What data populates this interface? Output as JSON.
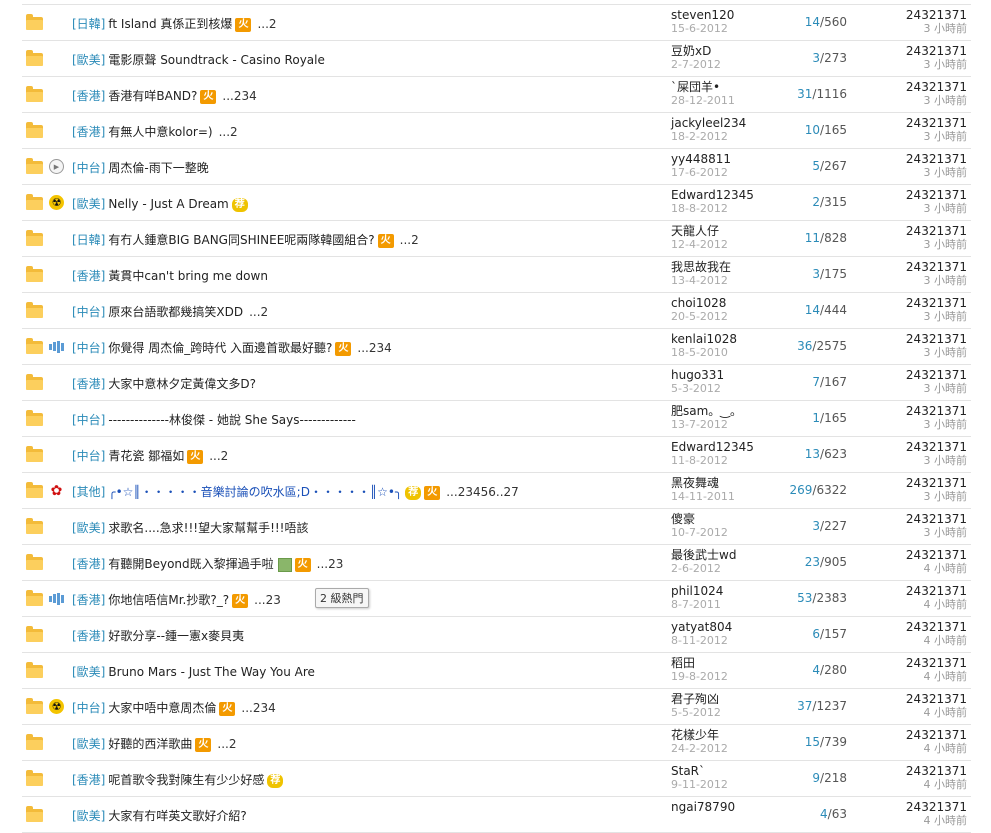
{
  "threads": [
    {
      "icon": "",
      "category": "[日韓]",
      "title": "ft Island 真係正到核爆",
      "badges": [
        "hot"
      ],
      "pages": [
        "...",
        "2"
      ],
      "author": "steven120",
      "date": "15-6-2012",
      "replies": "14",
      "views": "560",
      "last_user": "24321371",
      "last_time": "3 小時前"
    },
    {
      "icon": "",
      "category": "[歐美]",
      "title": "電影原聲 Soundtrack - Casino Royale",
      "badges": [],
      "pages": [],
      "author": "豆奶xD",
      "date": "2-7-2012",
      "replies": "3",
      "views": "273",
      "last_user": "24321371",
      "last_time": "3 小時前"
    },
    {
      "icon": "",
      "category": "[香港]",
      "title": "香港有咩BAND?",
      "badges": [
        "hot"
      ],
      "pages": [
        "...",
        "2",
        "3",
        "4"
      ],
      "author": "`屎団羊•",
      "date": "28-12-2011",
      "replies": "31",
      "views": "1116",
      "last_user": "24321371",
      "last_time": "3 小時前"
    },
    {
      "icon": "",
      "category": "[香港]",
      "title": "有無人中意kolor=)",
      "badges": [],
      "pages": [
        "...",
        "2"
      ],
      "author": "jackyleel234",
      "date": "18-2-2012",
      "replies": "10",
      "views": "165",
      "last_user": "24321371",
      "last_time": "3 小時前"
    },
    {
      "icon": "play",
      "category": "[中台]",
      "title": "周杰倫-雨下一整晚",
      "badges": [],
      "pages": [],
      "author": "yy448811",
      "date": "17-6-2012",
      "replies": "5",
      "views": "267",
      "last_user": "24321371",
      "last_time": "3 小時前"
    },
    {
      "icon": "nuke",
      "category": "[歐美]",
      "title": "Nelly - Just A Dream",
      "badges": [
        "rec"
      ],
      "pages": [],
      "author": "Edward12345",
      "date": "18-8-2012",
      "replies": "2",
      "views": "315",
      "last_user": "24321371",
      "last_time": "3 小時前"
    },
    {
      "icon": "",
      "category": "[日韓]",
      "title": "有冇人鍾意BIG BANG同SHINEE呢兩隊韓國組合?",
      "badges": [
        "hot"
      ],
      "pages": [
        "...",
        "2"
      ],
      "author": "天龍人仔",
      "date": "12-4-2012",
      "replies": "11",
      "views": "828",
      "last_user": "24321371",
      "last_time": "3 小時前"
    },
    {
      "icon": "",
      "category": "[香港]",
      "title": "黃貫中can't bring me down",
      "badges": [],
      "pages": [],
      "author": "我思故我在",
      "date": "13-4-2012",
      "replies": "3",
      "views": "175",
      "last_user": "24321371",
      "last_time": "3 小時前"
    },
    {
      "icon": "",
      "category": "[中台]",
      "title": "原來台語歌都幾搞笑XDD",
      "badges": [],
      "pages": [
        "...",
        "2"
      ],
      "author": "choi1028",
      "date": "20-5-2012",
      "replies": "14",
      "views": "444",
      "last_user": "24321371",
      "last_time": "3 小時前"
    },
    {
      "icon": "bars",
      "category": "[中台]",
      "title": "你覺得 周杰倫_跨時代 入面邊首歌最好聽?",
      "badges": [
        "hot"
      ],
      "pages": [
        "...",
        "2",
        "3",
        "4"
      ],
      "author": "kenlai1028",
      "date": "18-5-2010",
      "replies": "36",
      "views": "2575",
      "last_user": "24321371",
      "last_time": "3 小時前"
    },
    {
      "icon": "",
      "category": "[香港]",
      "title": "大家中意林夕定黃偉文多D?",
      "badges": [],
      "pages": [],
      "author": "hugo331",
      "date": "5-3-2012",
      "replies": "7",
      "views": "167",
      "last_user": "24321371",
      "last_time": "3 小時前"
    },
    {
      "icon": "",
      "category": "[中台]",
      "title": "--------------林俊傑 - 她說 She Says-------------",
      "badges": [],
      "pages": [],
      "author": "肥sam。‿。",
      "date": "13-7-2012",
      "replies": "1",
      "views": "165",
      "last_user": "24321371",
      "last_time": "3 小時前"
    },
    {
      "icon": "",
      "category": "[中台]",
      "title": "青花瓷 鄒福如",
      "badges": [
        "hot"
      ],
      "pages": [
        "...",
        "2"
      ],
      "author": "Edward12345",
      "date": "11-8-2012",
      "replies": "13",
      "views": "623",
      "last_user": "24321371",
      "last_time": "3 小時前"
    },
    {
      "icon": "rose",
      "category": "[其他]",
      "title": "╭•☆║・・・・・音樂討論の吹水區;D・・・・・║☆•╮",
      "title_blue": true,
      "badges": [
        "rec",
        "hot"
      ],
      "pages": [
        "...",
        "2",
        "3",
        "4",
        "5",
        "6",
        "..",
        "27"
      ],
      "author": "黑夜舞魂",
      "date": "14-11-2011",
      "replies": "269",
      "views": "6322",
      "last_user": "24321371",
      "last_time": "3 小時前"
    },
    {
      "icon": "",
      "category": "[歐美]",
      "title": "求歌名....急求!!!望大家幫幫手!!!唔該",
      "badges": [],
      "pages": [],
      "author": "傻豪",
      "date": "10-7-2012",
      "replies": "3",
      "views": "227",
      "last_user": "24321371",
      "last_time": "3 小時前"
    },
    {
      "icon": "",
      "category": "[香港]",
      "title": "有聽開Beyond既入黎揮過手啦",
      "badges": [
        "pic",
        "hot"
      ],
      "pages": [
        "...",
        "2",
        "3"
      ],
      "author": "最後武士wd",
      "date": "2-6-2012",
      "replies": "23",
      "views": "905",
      "last_user": "24321371",
      "last_time": "4 小時前"
    },
    {
      "icon": "bars",
      "category": "[香港]",
      "title": "你地信唔信Mr.抄歌?_?",
      "badges": [
        "hot"
      ],
      "pages": [
        "...",
        "2",
        "3"
      ],
      "tooltip": "2 級熱門",
      "author": "phil1024",
      "date": "8-7-2011",
      "replies": "53",
      "views": "2383",
      "last_user": "24321371",
      "last_time": "4 小時前"
    },
    {
      "icon": "",
      "category": "[香港]",
      "title": "好歌分享--鍾一憲x麥貝夷",
      "badges": [],
      "pages": [],
      "author": "yatyat804",
      "date": "8-11-2012",
      "replies": "6",
      "views": "157",
      "last_user": "24321371",
      "last_time": "4 小時前"
    },
    {
      "icon": "",
      "category": "[歐美]",
      "title": "Bruno Mars - Just The Way You Are",
      "badges": [],
      "pages": [],
      "author": "稻田",
      "date": "19-8-2012",
      "replies": "4",
      "views": "280",
      "last_user": "24321371",
      "last_time": "4 小時前"
    },
    {
      "icon": "nuke",
      "category": "[中台]",
      "title": "大家中唔中意周杰倫",
      "badges": [
        "hot"
      ],
      "pages": [
        "...",
        "2",
        "3",
        "4"
      ],
      "author": "君子殉凶",
      "date": "5-5-2012",
      "replies": "37",
      "views": "1237",
      "last_user": "24321371",
      "last_time": "4 小時前"
    },
    {
      "icon": "",
      "category": "[歐美]",
      "title": "好聽的西洋歌曲",
      "badges": [
        "hot"
      ],
      "pages": [
        "...",
        "2"
      ],
      "author": "花樣少年",
      "date": "24-2-2012",
      "replies": "15",
      "views": "739",
      "last_user": "24321371",
      "last_time": "4 小時前"
    },
    {
      "icon": "",
      "category": "[香港]",
      "title": "呢首歌令我對陳生有少少好感",
      "badges": [
        "rec"
      ],
      "pages": [],
      "author": "StaR`",
      "date": "9-11-2012",
      "replies": "9",
      "views": "218",
      "last_user": "24321371",
      "last_time": "4 小時前"
    },
    {
      "icon": "",
      "category": "[歐美]",
      "title": "大家有冇咩英文歌好介紹?",
      "badges": [],
      "pages": [],
      "author": "ngai78790",
      "date": "",
      "replies": "4",
      "views": "63",
      "last_user": "24321371",
      "last_time": "4 小時前"
    }
  ],
  "badge_text": {
    "hot": "火",
    "rec": "荐"
  },
  "colors": {
    "category": "#2b8bb8",
    "replies": "#2b8bb8",
    "folder": "#f3bb3a",
    "hot": "#f39a00",
    "rec": "#efc300"
  }
}
